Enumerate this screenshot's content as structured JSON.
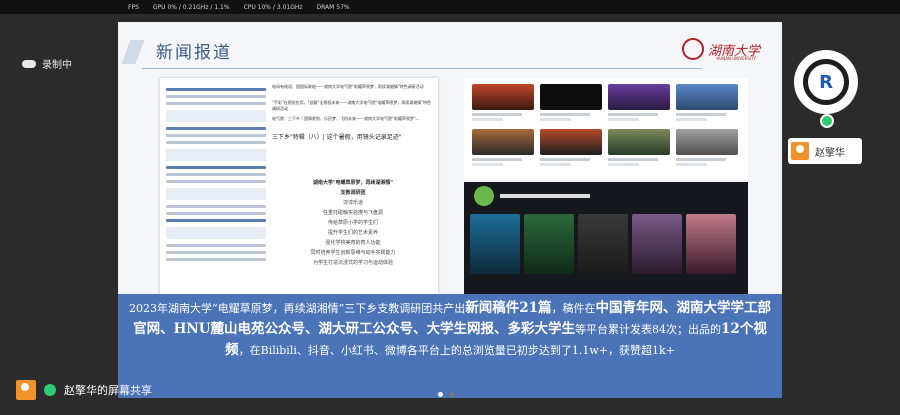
{
  "status_bar": {
    "fps": "FPS",
    "gpu": "GPU 0% / 0.21GHz / 1.1%",
    "cpu": "CPU 10% / 3.01GHz",
    "dram": "DRAM 57%"
  },
  "recording": {
    "label": "录制中"
  },
  "slide": {
    "title": "新闻报道",
    "logo_text": "湖南大学",
    "logo_sub": "HUNAN UNIVERSITY",
    "article": {
      "headlines": [
        "电母有效语、国国际联结——湖南大学电气院\"电耀草原梦，再续湖湘情\"特色调研活动",
        "\"手彩\"在视觉应用，\"创意\"全视程未来——湖南大学电气院\"电耀草原梦，再续湖湘情\"特色调研活动",
        "电气院：三下乡丨国情差别、乐民梦、飞机未来——湖南大学电气院\"电耀草原梦\"..."
      ],
      "highlight": "三下乡\"特辑（八）| 这个暑假，用镜头记录足迹\"",
      "poem": [
        "湖南大学\"电耀草原梦，再续湖湘情\"",
        "支教调研团",
        "谆谆乐道",
        "任重托碰触实验撩与飞盘调",
        "传给草原小学的学生们",
        "提升学生们的艺术素养",
        "强化学校美育的育人功能",
        "同时培养学生创新思维与动手实践能力",
        "为学生打造沉浸式的学习与运动体验"
      ]
    },
    "banner": {
      "p1": "2023年湖南大学“电耀草原梦，再续湖湘情”三下乡支教调研团共产出",
      "p2": "新闻稿件21篇",
      "p3": "，稿件在",
      "p4": "中国青年网、湖南大学学工部官网、HNU麓山电苑公众号、湖大研工公众号、大学生网报、多彩大学生",
      "p5": "等平台累计发表84次；出品的",
      "p6": "12个视频",
      "p7": "，在Bilibili、抖音、小红书、微博各平台上的总浏览量已初步达到了1.1w+，获赞超1k+"
    }
  },
  "presenter": {
    "name": "赵擎华"
  },
  "share": {
    "label": "赵擎华的屏幕共享"
  },
  "colors": {
    "banner": "#4a73b8",
    "accent": "#b32025"
  }
}
